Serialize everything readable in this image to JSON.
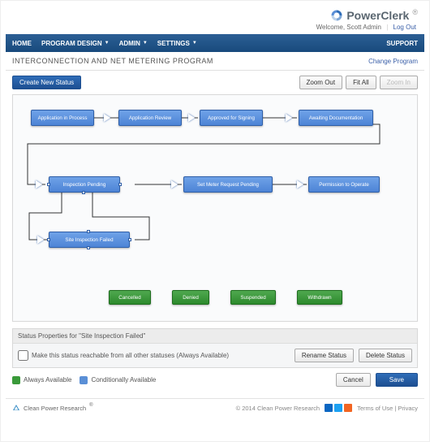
{
  "brand": "PowerClerk",
  "welcome_prefix": "Welcome,",
  "welcome_user": "Scott Admin",
  "logout": "Log Out",
  "nav": {
    "home": "HOME",
    "program_design": "PROGRAM DESIGN",
    "admin": "ADMIN",
    "settings": "SETTINGS",
    "support": "SUPPORT"
  },
  "program_title": "INTERCONNECTION AND NET METERING PROGRAM",
  "change_program": "Change Program",
  "toolbar": {
    "create_new_status": "Create New Status",
    "zoom_out": "Zoom Out",
    "fit_all": "Fit All",
    "zoom_in": "Zoom In"
  },
  "nodes": {
    "app_in_process": "Application in Process",
    "app_review": "Application Review",
    "approved_signing": "Approved for Signing",
    "awaiting_doc": "Awaiting Documentation",
    "inspection_pending": "Inspection Pending",
    "set_meter": "Set Meter Request Pending",
    "permission_operate": "Permission to Operate",
    "site_inspection_failed": "Site Inspection Failed",
    "cancelled": "Cancelled",
    "denied": "Denied",
    "suspended": "Suspended",
    "withdrawn": "Withdrawn"
  },
  "panel": {
    "title_prefix": "Status Properties for",
    "title_status": "\"Site Inspection Failed\"",
    "checkbox_label": "Make this status reachable from all other statuses (Always Available)",
    "rename": "Rename Status",
    "delete": "Delete Status"
  },
  "legend": {
    "always": "Always Available",
    "conditionally": "Conditionally Available"
  },
  "actions": {
    "cancel": "Cancel",
    "save": "Save"
  },
  "footer": {
    "cpr": "Clean Power Research",
    "copyright": "© 2014  Clean Power Research",
    "terms": "Terms of Use",
    "privacy": "Privacy"
  },
  "colors": {
    "linkedin": "#0a66c2",
    "twitter": "#1da1f2",
    "rss": "#f26522"
  }
}
